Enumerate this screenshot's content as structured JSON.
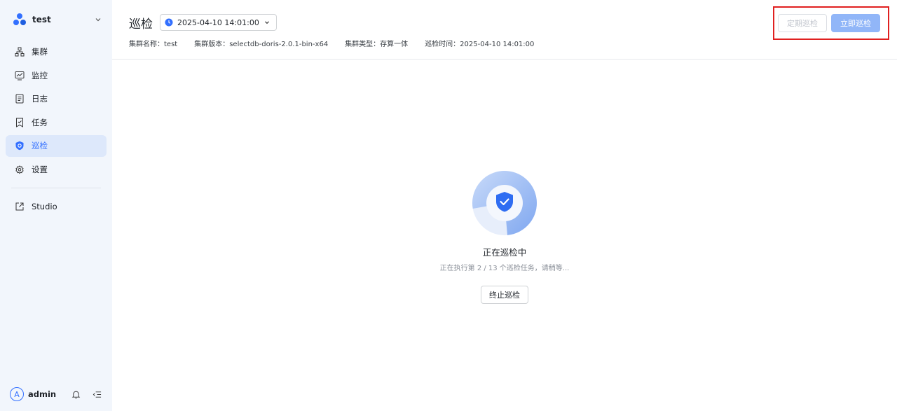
{
  "sidebar": {
    "cluster_name": "test",
    "items": [
      {
        "label": "集群",
        "icon": "cluster-icon"
      },
      {
        "label": "监控",
        "icon": "monitor-icon"
      },
      {
        "label": "日志",
        "icon": "log-icon"
      },
      {
        "label": "任务",
        "icon": "task-icon"
      },
      {
        "label": "巡检",
        "icon": "inspection-shield-icon"
      },
      {
        "label": "设置",
        "icon": "gear-icon"
      }
    ],
    "studio": {
      "label": "Studio",
      "icon": "external-link-icon"
    },
    "active_index": 4,
    "user": {
      "initial": "A",
      "name": "admin"
    }
  },
  "header": {
    "title": "巡检",
    "time_value": "2025-04-10 14:01:00",
    "meta": [
      "集群名称：test",
      "集群版本：selectdb-doris-2.0.1-bin-x64",
      "集群类型：存算一体",
      "巡检时间：2025-04-10 14:01:00"
    ],
    "actions": {
      "scheduled_label": "定期巡检",
      "run_now_label": "立即巡检"
    }
  },
  "progress": {
    "title": "正在巡检中",
    "description": "正在执行第 2 / 13 个巡检任务，请稍等...",
    "current": 2,
    "total": 13,
    "stop_label": "终止巡检"
  },
  "colors": {
    "accent": "#3370ff",
    "sidebar_bg": "#f2f6fc",
    "active_bg": "#dde8fb",
    "primary_disabled": "#91b6f8",
    "highlight_border": "#e02020"
  }
}
